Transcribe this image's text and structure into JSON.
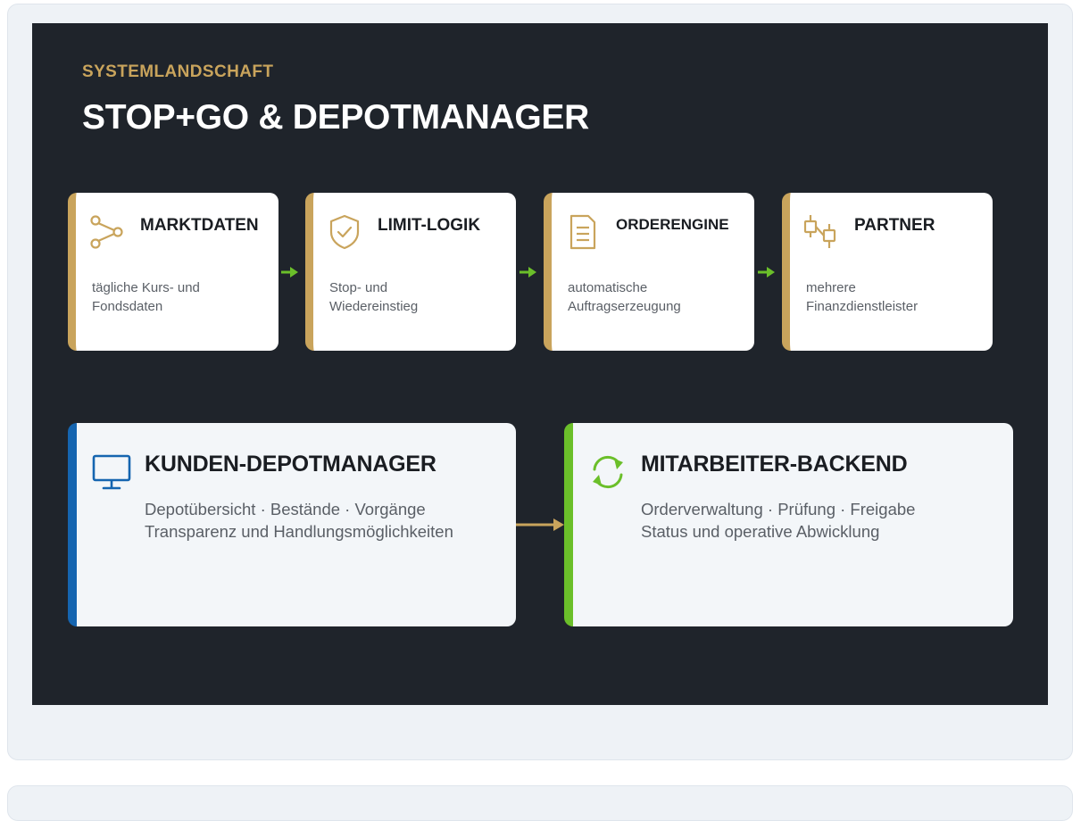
{
  "header": {
    "eyebrow": "SYSTEMLANDSCHAFT",
    "title": "STOP+GO & DEPOTMANAGER"
  },
  "colors": {
    "panel_bg": "#1f242b",
    "gold": "#c9a45c",
    "green": "#6bbf2a",
    "blue": "#1565b0"
  },
  "steps": [
    {
      "title": "MARKTDATEN",
      "icon": "share-nodes-icon",
      "desc_line1": "tägliche Kurs- und",
      "desc_line2": "Fondsdaten"
    },
    {
      "title": "LIMIT-LOGIK",
      "icon": "shield-check-icon",
      "desc_line1": "Stop- und",
      "desc_line2": "Wiedereinstieg"
    },
    {
      "title": "ORDERENGINE",
      "icon": "document-icon",
      "desc_line1": "automatische",
      "desc_line2": "Auftragserzeugung"
    },
    {
      "title": "PARTNER",
      "icon": "linked-boxes-icon",
      "desc_line1": "mehrere",
      "desc_line2": "Finanzdienstleister"
    }
  ],
  "systems": [
    {
      "title": "KUNDEN-DEPOTMANAGER",
      "icon": "monitor-icon",
      "line1": "Depotübersicht · Bestände · Vorgänge",
      "line2": "Transparenz und Handlungsmöglichkeiten"
    },
    {
      "title": "MITARBEITER-BACKEND",
      "icon": "refresh-icon",
      "line1": "Orderverwaltung · Prüfung · Freigabe",
      "line2": "Status und operative Abwicklung"
    }
  ]
}
